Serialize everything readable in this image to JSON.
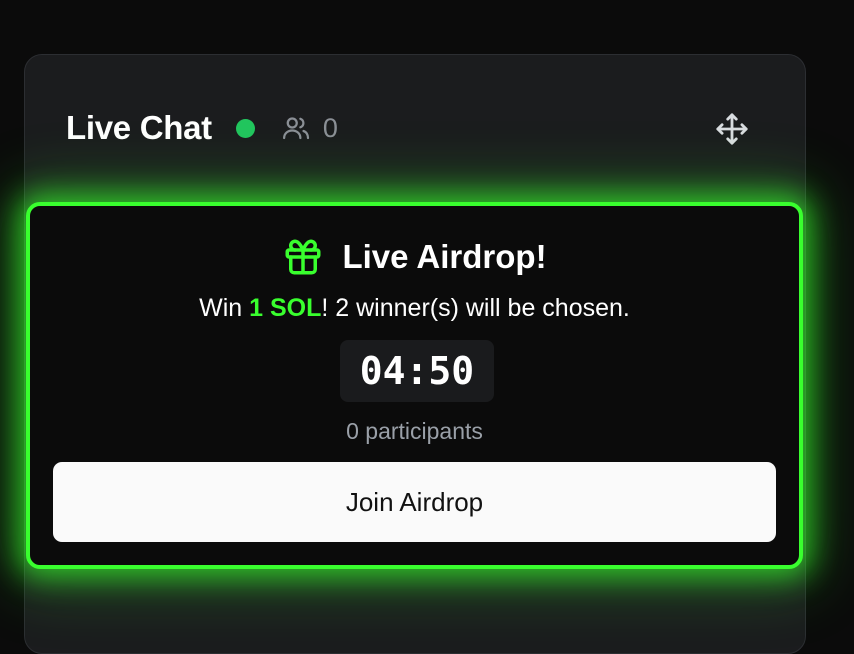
{
  "header": {
    "title": "Live Chat",
    "user_count": "0",
    "status_color": "#22c55e",
    "icons": [
      "users-icon",
      "move-icon"
    ]
  },
  "airdrop": {
    "title": "Live Airdrop!",
    "icon": "gift-icon",
    "subtitle_prefix": "Win ",
    "prize": "1 SOL",
    "subtitle_suffix": "! 2 winner(s) will be chosen.",
    "timer": "04:50",
    "participants": "0 participants",
    "join_label": "Join Airdrop",
    "accent_color": "#39ff2e"
  }
}
